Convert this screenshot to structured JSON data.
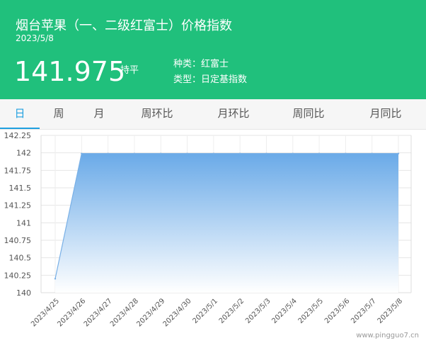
{
  "header": {
    "title": "烟台苹果（一、二级红富士）价格指数",
    "date": "2023/5/8",
    "price": "141.975",
    "status": "持平",
    "variety": "种类：红富士",
    "type": "类型：日定基指数"
  },
  "tabs": [
    {
      "label": "日",
      "active": true
    },
    {
      "label": "周",
      "active": false
    },
    {
      "label": "月",
      "active": false
    },
    {
      "label": "周环比",
      "active": false
    },
    {
      "label": "月环比",
      "active": false
    },
    {
      "label": "周同比",
      "active": false
    },
    {
      "label": "月同比",
      "active": false
    }
  ],
  "chart_data": {
    "type": "area",
    "x": [
      "2023/4/25",
      "2023/4/26",
      "2023/4/27",
      "2023/4/28",
      "2023/4/29",
      "2023/4/30",
      "2023/5/1",
      "2023/5/2",
      "2023/5/3",
      "2023/5/4",
      "2023/5/5",
      "2023/5/6",
      "2023/5/7",
      "2023/5/8"
    ],
    "y": [
      140.2,
      141.99,
      141.99,
      141.99,
      141.99,
      141.99,
      141.99,
      141.99,
      141.99,
      141.99,
      141.99,
      141.99,
      141.99,
      141.99
    ],
    "ylim": [
      140,
      142.25
    ],
    "yticks": [
      "140",
      "140.25",
      "140.5",
      "140.75",
      "141",
      "141.25",
      "141.5",
      "141.75",
      "142",
      "142.25"
    ],
    "grid": true,
    "colors": {
      "fill_top": "#6aaae8",
      "fill_bottom": "#ffffff",
      "line": "#79b0e6"
    }
  },
  "watermark": "www.pingguo7.cn"
}
